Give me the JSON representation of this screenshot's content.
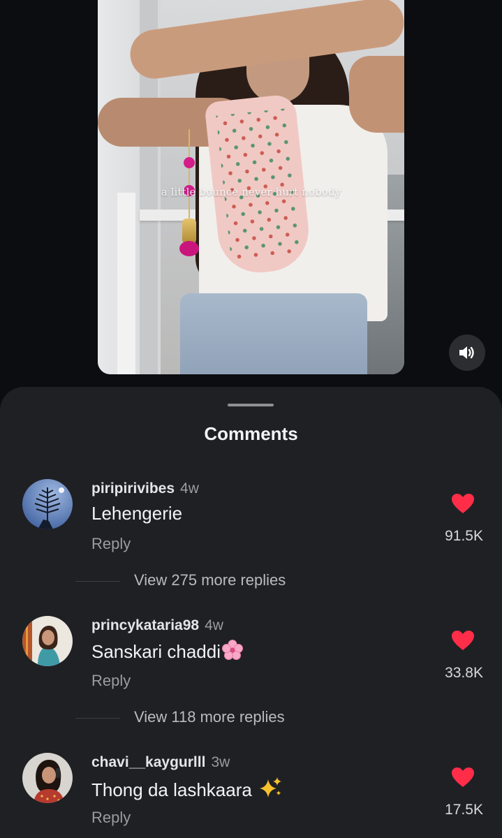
{
  "video": {
    "caption_overlay": "a little bounce never hurt nobody",
    "sound_icon": "speaker-volume-icon"
  },
  "comments_sheet": {
    "title": "Comments",
    "comments": [
      {
        "username": "piripirivibes",
        "time": "4w",
        "text": "Lehengerie",
        "reply_label": "Reply",
        "likes": "91.5K",
        "like_icon": "heart-icon",
        "view_replies": "View 275 more replies"
      },
      {
        "username": "princykataria98",
        "time": "4w",
        "text": "Sanskari chaddi",
        "text_emoji": "cherry-blossom-icon",
        "reply_label": "Reply",
        "likes": "33.8K",
        "like_icon": "heart-icon",
        "view_replies": "View 118 more replies"
      },
      {
        "username": "chavi__kaygurlll",
        "time": "3w",
        "text": "Thong da lashkaara",
        "text_emoji": "sparkles-icon",
        "reply_label": "Reply",
        "likes": "17.5K",
        "like_icon": "heart-icon"
      }
    ]
  },
  "colors": {
    "background": "#0b0d10",
    "sheet": "#1f2024",
    "heart": "#ff2d48",
    "muted_text": "#9a9ca1"
  }
}
